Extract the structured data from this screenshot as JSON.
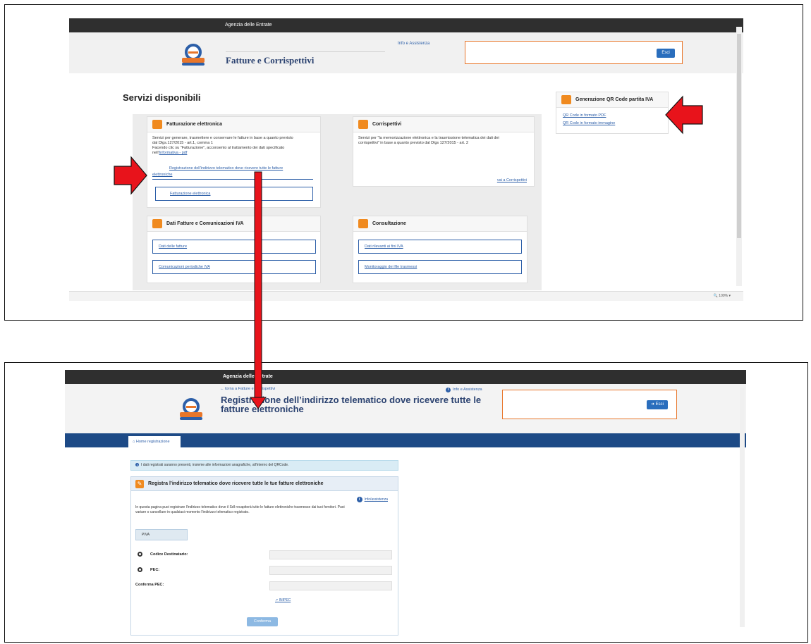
{
  "top": {
    "topbar_title": "Agenzia delle Entrate",
    "brand_title": "Fatture e Corrispettivi",
    "info_link": "Info e Assistenza",
    "exit_label": "Esci",
    "section_title": "Servizi disponibili",
    "card_fatturazione": {
      "title": "Fatturazione elettronica",
      "desc_1": "Servizi per generare, trasmettere e conservare le fatture in base a quanto previsto",
      "desc_2": "dal Dlgs.127/2015 - art.1, comma 1",
      "desc_3": "Facendo clic su \"Fatturazione\", acconsento al trattamento dei dati specificato",
      "desc_4_prefix": "nell'",
      "desc_4_link": "Informativa - pdf",
      "btn_registrazione_1": "Registrazione dell'indirizzo telematico dove ricevere tutte le fatture",
      "btn_registrazione_2": "elettroniche",
      "btn_fatturazione": "Fatturazione elettronica"
    },
    "card_corrispettivi": {
      "title": "Corrispettivi",
      "desc_1": "Servizi per \"la memorizzazione elettronica e la trasmissione telematica dei dati dei",
      "desc_2": "corrispettivi\" in base a quanto previsto dal Dlgs 127/2015 - art. 2",
      "link": "vai a Corrispettivi"
    },
    "card_dati": {
      "title": "Dati Fatture e Comunicazioni IVA",
      "btn_1": "Dati delle fatture",
      "btn_2": "Comunicazioni periodiche IVA"
    },
    "card_consultazione": {
      "title": "Consultazione",
      "btn_1": "Dati rilevanti ai fini IVA",
      "btn_2": "Monitoraggio dei file trasmessi"
    },
    "qr_card": {
      "title": "Generazione QR Code partita IVA",
      "link_1": "QR Code in formato PDF",
      "link_2": "QR Code in formato immagine"
    },
    "zoom": "100%"
  },
  "bottom": {
    "topbar_title": "Agenzia delle Entrate",
    "back_link": "torna a Fatture e Corrispettivi",
    "info_link": "Info e Assistenza",
    "page_title": "Registrazione dell’indirizzo telematico dove ricevere tutte le fatture elettroniche",
    "exit_label": "Esci",
    "nav_tab": "Home registrazione",
    "alert": "I dati registrati saranno presenti, insieme alle informazioni anagrafiche, all'interno del QRCode.",
    "form_title": "Registra l’indirizzo telematico dove ricevere tutte le tue fatture elettroniche",
    "info_assist": "Info/assistenza",
    "desc_1": "In questa pagina puoi registrare l'indirizzo telematico dove il SdI recapiterà tutte le fatture elettroniche trasmesse dai tuoi fornitori. Puoi",
    "desc_2": "variare o cancellare in qualsiasi momento l'indirizzo telematico registrato.",
    "piva_label": "PIVA",
    "codice_label": "Codice Destinatario:",
    "pec_label": "PEC:",
    "conferma_pec_label": "Conferma PEC:",
    "inipec": "INIPEC",
    "confirm_btn": "Conferma"
  },
  "annotations": {
    "arrow_color": "#e8131b",
    "arrow_outline": "#111111"
  }
}
